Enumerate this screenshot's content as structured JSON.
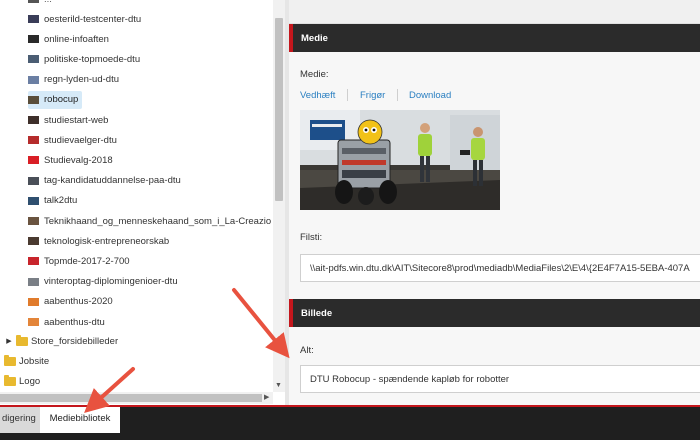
{
  "tree": {
    "items": [
      {
        "label": "oesterild-testcenter-dtu",
        "thumb": "#3a3d58"
      },
      {
        "label": "online-infoaften",
        "thumb": "#2a2a2a"
      },
      {
        "label": "politiske-topmoede-dtu",
        "thumb": "#4b5d73"
      },
      {
        "label": "regn-lyden-ud-dtu",
        "thumb": "#6b7fa3"
      },
      {
        "label": "robocup",
        "thumb": "#5a4d3a"
      },
      {
        "label": "studiestart-web",
        "thumb": "#3e2f2a"
      },
      {
        "label": "studievaelger-dtu",
        "thumb": "#b52c2c"
      },
      {
        "label": "Studievalg-2018",
        "thumb": "#d91f26"
      },
      {
        "label": "tag-kandidatuddannelse-paa-dtu",
        "thumb": "#4a4f58"
      },
      {
        "label": "talk2dtu",
        "thumb": "#2f4f6f"
      },
      {
        "label": "Teknikhaand_og_menneskehaand_som_i_La-Creazio",
        "thumb": "#6a5440"
      },
      {
        "label": "teknologisk-entrepreneorskab",
        "thumb": "#4a3a30"
      },
      {
        "label": "Topmde-2017-2-700",
        "thumb": "#c8252c"
      },
      {
        "label": "vinteroptag-diplomingenioer-dtu",
        "thumb": "#7a7f86"
      },
      {
        "label": "aabenthus-2020",
        "thumb": "#e07b2c"
      },
      {
        "label": "aabenthus-dtu",
        "thumb": "#e3853a"
      }
    ],
    "selected_index": 4,
    "roots": [
      {
        "label": "Store_forsidebilleder",
        "expander": "▶"
      },
      {
        "label": "Jobsite",
        "expander": ""
      },
      {
        "label": "Logo",
        "expander": ""
      }
    ]
  },
  "media_section": {
    "title": "Medie",
    "field_label": "Medie:",
    "actions": [
      "Vedhæft",
      "Frigør",
      "Download"
    ],
    "path_label": "Filsti:",
    "path_value": "\\\\ait-pdfs.win.dtu.dk\\AIT\\Sitecore8\\prod\\mediadb\\MediaFiles\\2\\E\\4\\{2E4F7A15-5EBA-407A"
  },
  "image_section": {
    "title": "Billede",
    "alt_label": "Alt:",
    "alt_value": "DTU Robocup - spændende kapløb for robotter"
  },
  "bottom_tabs": {
    "editing": "digering",
    "media_library": "Mediebibliotek"
  },
  "colors": {
    "accent_red": "#c4161c",
    "header_dark": "#2b2b2b",
    "link_blue": "#2a7fc1",
    "selected_row": "#d6eaf8",
    "annotation_arrow": "#e8523f"
  },
  "icons": {
    "tree_expander": "triangle-right-icon",
    "root_folder": "folder-icon",
    "annotation": "arrow-icon"
  }
}
